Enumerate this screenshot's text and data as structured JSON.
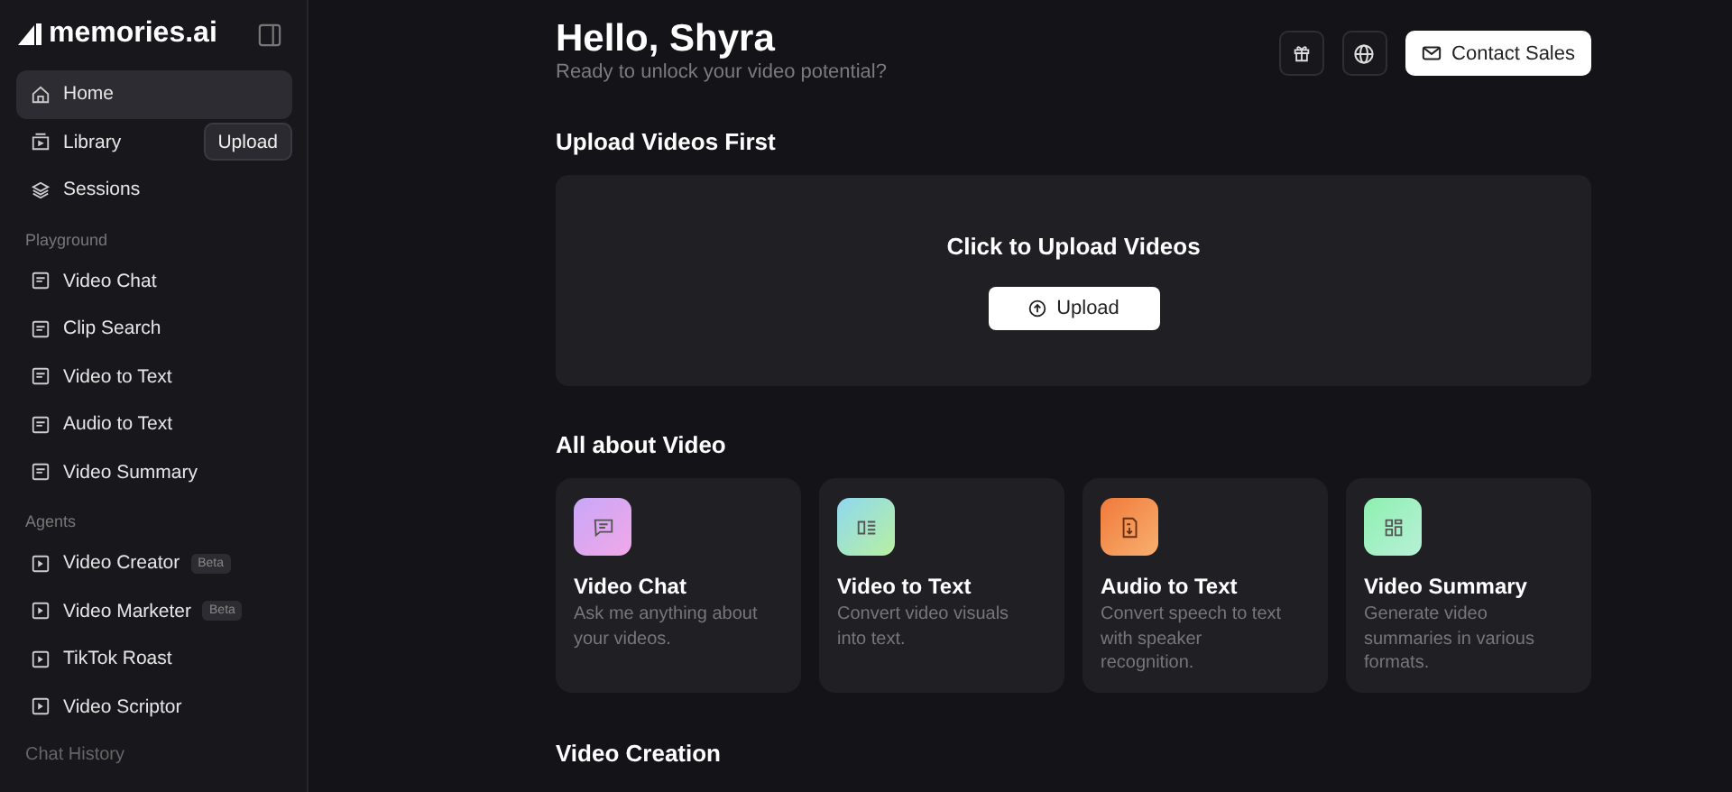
{
  "sidebar": {
    "logo": "memories.ai",
    "items": [
      {
        "label": "Home",
        "selected": true
      },
      {
        "label": "Library",
        "selected": false,
        "action": "Upload"
      },
      {
        "label": "Sessions",
        "selected": false
      }
    ],
    "groups": [
      {
        "title": "Playground",
        "items": [
          {
            "label": "Video Chat"
          },
          {
            "label": "Clip Search"
          },
          {
            "label": "Video to Text"
          },
          {
            "label": "Audio to Text"
          },
          {
            "label": "Video Summary"
          }
        ]
      },
      {
        "title": "Agents",
        "items": [
          {
            "label": "Video Creator",
            "badge": "Beta"
          },
          {
            "label": "Video Marketer",
            "badge": "Beta"
          },
          {
            "label": "TikTok Roast"
          },
          {
            "label": "Video Scriptor"
          }
        ]
      }
    ],
    "history_title": "Chat History"
  },
  "header": {
    "greeting": "Hello, Shyra",
    "subtitle": "Ready to unlock your video potential?",
    "contact_button": "Contact Sales"
  },
  "upload": {
    "heading": "Upload Videos First",
    "prompt": "Click to Upload Videos",
    "button": "Upload"
  },
  "about": {
    "heading": "All about Video",
    "cards": [
      {
        "title": "Video Chat",
        "description": "Ask me anything about your videos."
      },
      {
        "title": "Video to Text",
        "description": "Convert video visuals into text."
      },
      {
        "title": "Audio to Text",
        "description": "Convert speech to text with speaker recognition."
      },
      {
        "title": "Video Summary",
        "description": "Generate video summaries in various formats."
      }
    ]
  },
  "creation": {
    "heading": "Video Creation"
  }
}
